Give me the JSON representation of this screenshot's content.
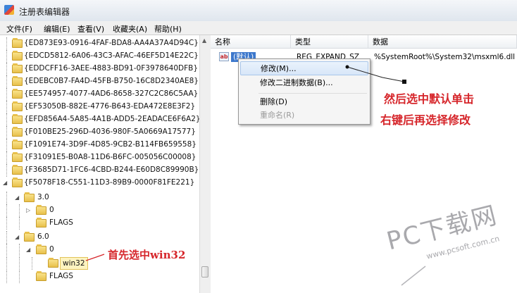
{
  "window": {
    "title": "注册表编辑器"
  },
  "menu": [
    "文件(F)",
    "编辑(E)",
    "查看(V)",
    "收藏夹(A)",
    "帮助(H)"
  ],
  "tree": {
    "guids": [
      "{ED873E93-0916-4FAF-BDA8-AA4A37A4D94C}",
      "{EDCD5812-6A06-43C3-AFAC-46EF5D14E22C}",
      "{EDDCFF16-3AEE-4883-BD91-0F3978640DFB}",
      "{EDEBC0B7-FA4D-45FB-B750-16C8D2340AE8}",
      "{EE574957-4077-4AD6-8658-327C2C86C5AA}",
      "{EF53050B-882E-4776-B643-EDA472E8E3F2}",
      "{EFD856A4-5A85-4A1B-ADD5-2EADACE6F6A2}",
      "{F010BE25-296D-4036-980F-5A0669A17577}",
      "{F1091E74-3D9F-4D85-9CB2-B114FB659558}",
      "{F31091E5-B0A8-11D6-B6FC-005056C00008}",
      "{F3685D71-1FC6-4CBD-B244-E60D8C89990B}",
      "{F5078F18-C551-11D3-89B9-0000F81FE221}"
    ],
    "children": [
      {
        "label": "3.0"
      },
      {
        "label": "0"
      },
      {
        "label": "FLAGS"
      },
      {
        "label": "6.0"
      },
      {
        "label": "0"
      },
      {
        "label": "win32"
      },
      {
        "label": "FLAGS"
      }
    ]
  },
  "list": {
    "columns": [
      "名称",
      "类型",
      "数据"
    ],
    "row": {
      "name": "(默认)",
      "type": "REG_EXPAND_SZ",
      "data": "%SystemRoot%\\System32\\msxml6.dll"
    }
  },
  "context_menu": [
    {
      "label": "修改(M)...",
      "enabled": true
    },
    {
      "label": "修改二进制数据(B)...",
      "enabled": true
    },
    {
      "label": "删除(D)",
      "enabled": true
    },
    {
      "label": "重命名(R)",
      "enabled": false
    }
  ],
  "annotations": {
    "right_line1": "然后选中默认单击",
    "right_line2": "右键后再选择修改",
    "left": "首先选中win32"
  },
  "watermark": {
    "title": "PC下载网",
    "url": "www.pcsoft.com.cn"
  },
  "colors": {
    "annotation": "#d6262b",
    "selection": "#3d78cc",
    "watermark": "#a9a9ad"
  }
}
